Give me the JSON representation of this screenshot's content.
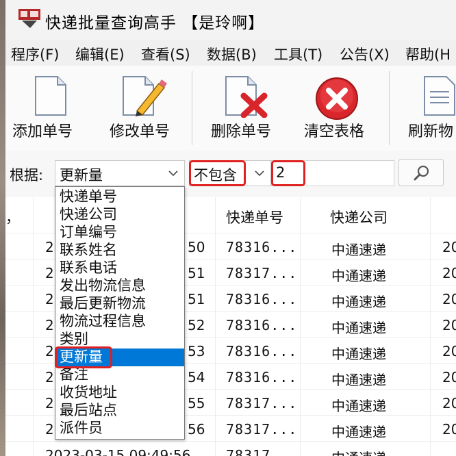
{
  "window": {
    "title": "快递批量查询高手 【是玲啊】"
  },
  "menu": [
    "程序(F)",
    "编辑(E)",
    "查看(S)",
    "数据(B)",
    "工具(T)",
    "公告(X)",
    "帮助(H"
  ],
  "toolbar": {
    "add": "添加单号",
    "edit": "修改单号",
    "delete": "删除单号",
    "clear": "清空表格",
    "refresh": "刷新物"
  },
  "filter": {
    "label": "根据:",
    "field_value": "更新量",
    "condition_value": "不包含",
    "input_value": "2"
  },
  "dropdown": {
    "items": [
      "快递单号",
      "快递公司",
      "订单编号",
      "联系姓名",
      "联系电话",
      "发出物流信息",
      "最后更新物流",
      "物流过程信息",
      "类别",
      "更新量",
      "备注",
      "收货地址",
      "最后站点",
      "派件员"
    ],
    "selected_index": 9
  },
  "table": {
    "headers": {
      "left": "，",
      "tracking": "快递单号",
      "company": "快递公司"
    },
    "rows": [
      {
        "a": "2",
        "b": "50",
        "tracking": "78316...",
        "company": "中通速递",
        "d": "20"
      },
      {
        "a": "2",
        "b": "51",
        "tracking": "78317...",
        "company": "中通速递",
        "d": "20"
      },
      {
        "a": "2",
        "b": "51",
        "tracking": "78316...",
        "company": "中通速递",
        "d": "20"
      },
      {
        "a": "2",
        "b": "52",
        "tracking": "78316...",
        "company": "中通速递",
        "d": "20"
      },
      {
        "a": "2",
        "b": "53",
        "tracking": "78316...",
        "company": "中通速递",
        "d": "20"
      },
      {
        "a": "2",
        "b": "54",
        "tracking": "78316...",
        "company": "中通速递",
        "d": "20"
      },
      {
        "a": "2",
        "b": "55",
        "tracking": "78317...",
        "company": "中通速递",
        "d": "20"
      },
      {
        "a": "2",
        "b": "56",
        "tracking": "78317...",
        "company": "中通速递",
        "d": "20"
      }
    ],
    "partial_row": {
      "datetime": "2023-03-15 09:49:56",
      "tracking": "78317",
      "company": "中通速递"
    }
  },
  "colors": {
    "highlight": "#e02020",
    "selection": "#0078d7"
  }
}
